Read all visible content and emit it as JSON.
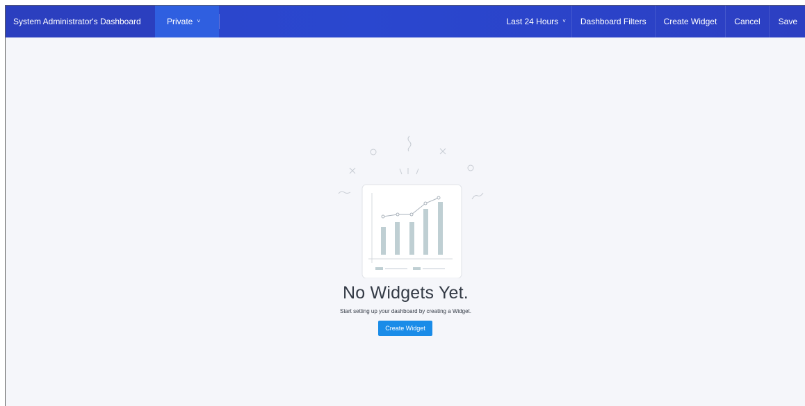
{
  "header": {
    "title": "System Administrator's Dashboard",
    "visibility": "Private",
    "time_range": "Last 24 Hours",
    "filters_label": "Dashboard Filters",
    "create_widget_label": "Create Widget",
    "cancel_label": "Cancel",
    "save_label": "Save"
  },
  "empty_state": {
    "title": "No Widgets Yet.",
    "subtitle": "Start setting up your dashboard by creating a Widget.",
    "button_label": "Create Widget"
  },
  "icons": {
    "dropdown": "chevron-down-icon",
    "illustration": "bar-chart-illustration"
  },
  "colors": {
    "header_start": "#2d45c8",
    "header_end": "#2c3fc2",
    "private_tab": "#2f5fe0",
    "primary_button": "#1a8ce8",
    "background": "#f5f6fa"
  }
}
